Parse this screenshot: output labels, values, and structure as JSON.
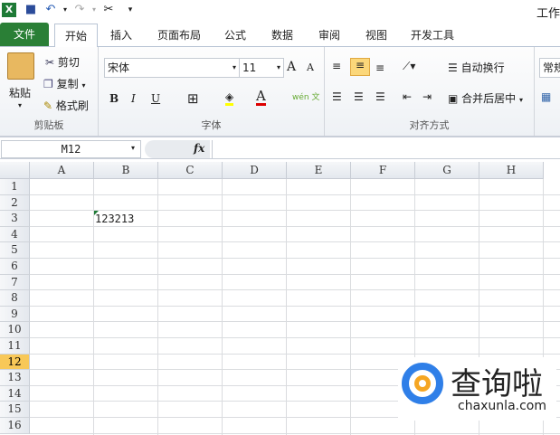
{
  "title": "工作",
  "tabs": {
    "file": "文件",
    "items": [
      "开始",
      "插入",
      "页面布局",
      "公式",
      "数据",
      "审阅",
      "视图",
      "开发工具"
    ]
  },
  "clipboard": {
    "paste": "粘贴",
    "cut": "剪切",
    "copy": "复制",
    "format_painter": "格式刷",
    "label": "剪贴板"
  },
  "font": {
    "name": "宋体",
    "size": "11",
    "bold": "B",
    "italic": "I",
    "underline": "U",
    "label": "字体",
    "grow": "A",
    "shrink": "A",
    "font_color": "A",
    "wen": "wén 文"
  },
  "align": {
    "wrap": "自动换行",
    "merge": "合并后居中",
    "label": "对齐方式"
  },
  "number": {
    "format": "常规"
  },
  "formula_bar": {
    "name_box": "M12",
    "fx": "fx",
    "value": ""
  },
  "columns": [
    "A",
    "B",
    "C",
    "D",
    "E",
    "F",
    "G",
    "H"
  ],
  "rows": [
    "1",
    "2",
    "3",
    "4",
    "5",
    "6",
    "7",
    "8",
    "9",
    "10",
    "11",
    "12",
    "13",
    "14",
    "15",
    "16"
  ],
  "selected_row": "12",
  "cells": {
    "B3": "123213"
  },
  "watermark": {
    "name": "查询啦",
    "url": "chaxunla.com"
  },
  "colors": {
    "file_tab": "#2a7f36",
    "selected_header": "#f8c858",
    "accent_blue": "#2f7fe8",
    "accent_orange": "#f5a623"
  }
}
